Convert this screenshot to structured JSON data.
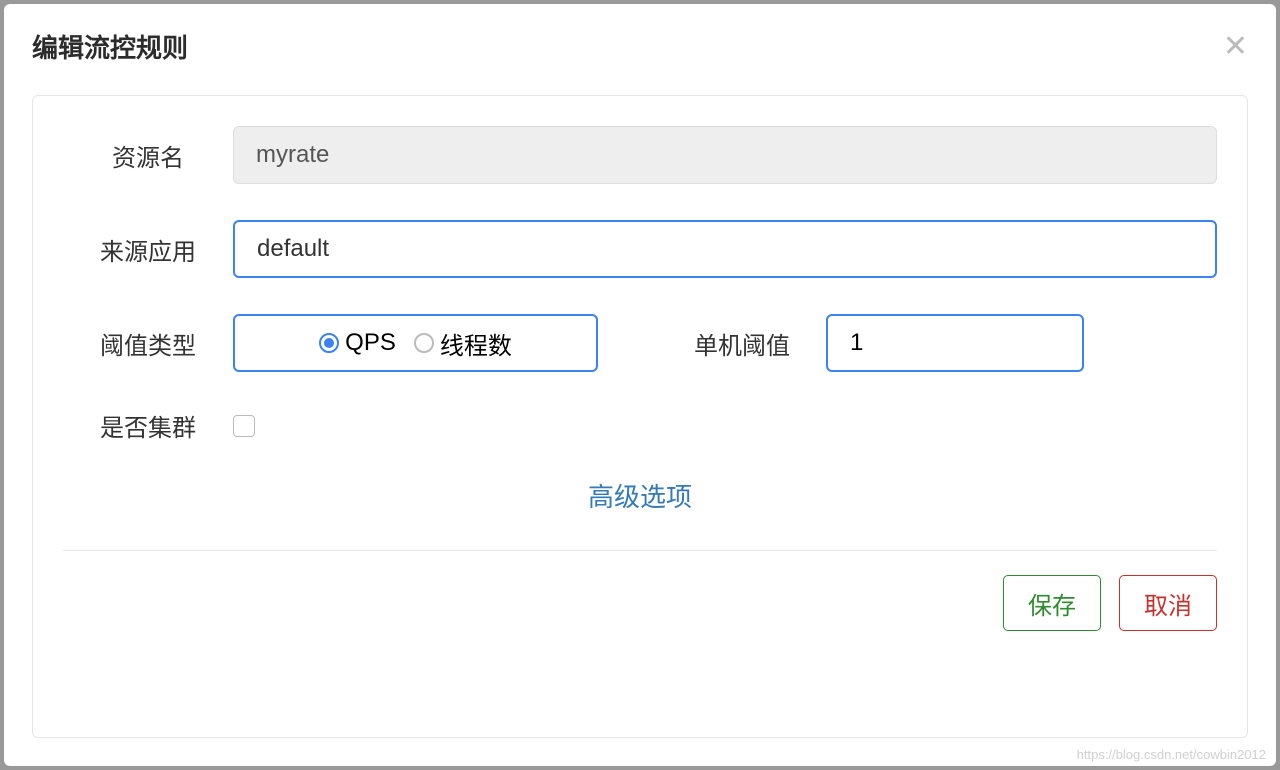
{
  "modal": {
    "title": "编辑流控规则"
  },
  "form": {
    "resource": {
      "label": "资源名",
      "value": "myrate"
    },
    "source": {
      "label": "来源应用",
      "value": "default"
    },
    "threshold_type": {
      "label": "阈值类型",
      "options": {
        "qps": "QPS",
        "thread": "线程数"
      }
    },
    "threshold": {
      "label": "单机阈值",
      "value": "1"
    },
    "cluster": {
      "label": "是否集群"
    },
    "advanced": "高级选项"
  },
  "buttons": {
    "save": "保存",
    "cancel": "取消"
  },
  "watermark": "https://blog.csdn.net/cowbin2012"
}
